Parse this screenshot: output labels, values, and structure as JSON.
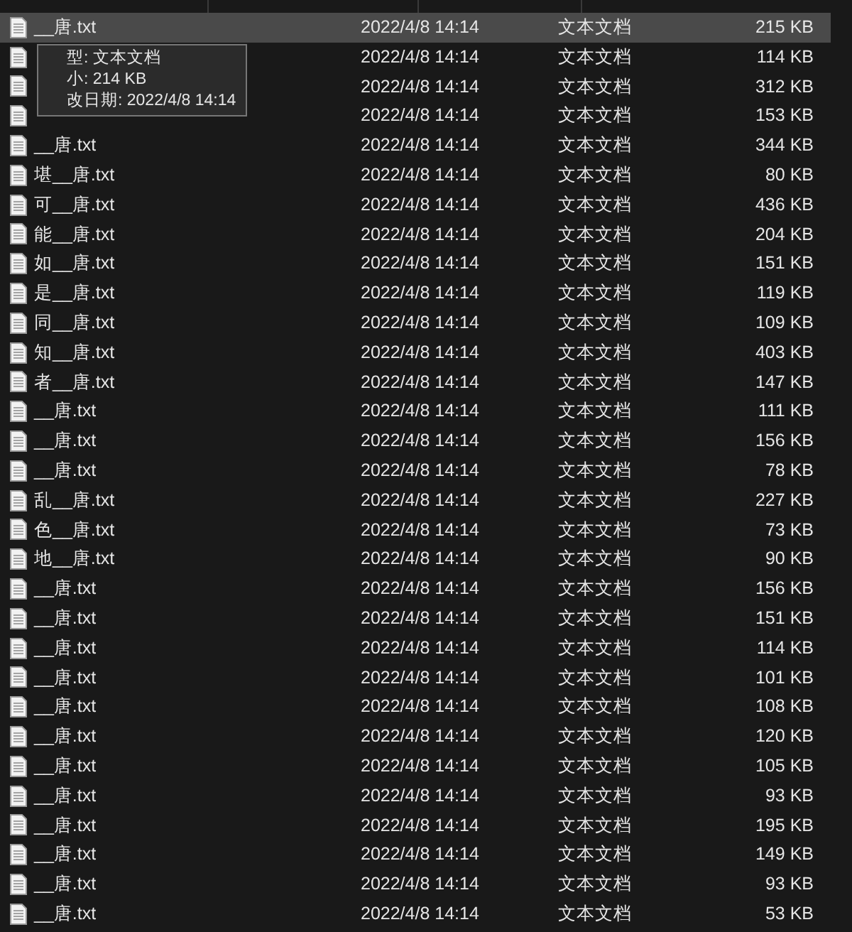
{
  "files": [
    {
      "name": "__唐.txt",
      "modified": "2022/4/8 14:14",
      "type": "文本文档",
      "size": "215 KB",
      "selected": true
    },
    {
      "modified": "2022/4/8 14:14",
      "type": "文本文档",
      "size": "114 KB",
      "selected": false
    },
    {
      "modified": "2022/4/8 14:14",
      "type": "文本文档",
      "size": "312 KB",
      "selected": false
    },
    {
      "modified": "2022/4/8 14:14",
      "type": "文本文档",
      "size": "153 KB",
      "selected": false
    },
    {
      "name": "__唐.txt",
      "modified": "2022/4/8 14:14",
      "type": "文本文档",
      "size": "344 KB",
      "selected": false
    },
    {
      "name": "堪__唐.txt",
      "modified": "2022/4/8 14:14",
      "type": "文本文档",
      "size": "80 KB",
      "selected": false
    },
    {
      "name": "可__唐.txt",
      "modified": "2022/4/8 14:14",
      "type": "文本文档",
      "size": "436 KB",
      "selected": false
    },
    {
      "name": "能__唐.txt",
      "modified": "2022/4/8 14:14",
      "type": "文本文档",
      "size": "204 KB",
      "selected": false
    },
    {
      "name": "如__唐.txt",
      "modified": "2022/4/8 14:14",
      "type": "文本文档",
      "size": "151 KB",
      "selected": false
    },
    {
      "name": "是__唐.txt",
      "modified": "2022/4/8 14:14",
      "type": "文本文档",
      "size": "119 KB",
      "selected": false
    },
    {
      "name": "同__唐.txt",
      "modified": "2022/4/8 14:14",
      "type": "文本文档",
      "size": "109 KB",
      "selected": false
    },
    {
      "name": "知__唐.txt",
      "modified": "2022/4/8 14:14",
      "type": "文本文档",
      "size": "403 KB",
      "selected": false
    },
    {
      "name": "者__唐.txt",
      "modified": "2022/4/8 14:14",
      "type": "文本文档",
      "size": "147 KB",
      "selected": false
    },
    {
      "name": "__唐.txt",
      "modified": "2022/4/8 14:14",
      "type": "文本文档",
      "size": "111 KB",
      "selected": false
    },
    {
      "name": "__唐.txt",
      "modified": "2022/4/8 14:14",
      "type": "文本文档",
      "size": "156 KB",
      "selected": false
    },
    {
      "name": "__唐.txt",
      "modified": "2022/4/8 14:14",
      "type": "文本文档",
      "size": "78 KB",
      "selected": false
    },
    {
      "name": "乱__唐.txt",
      "modified": "2022/4/8 14:14",
      "type": "文本文档",
      "size": "227 KB",
      "selected": false
    },
    {
      "name": "色__唐.txt",
      "modified": "2022/4/8 14:14",
      "type": "文本文档",
      "size": "73 KB",
      "selected": false
    },
    {
      "name": "地__唐.txt",
      "modified": "2022/4/8 14:14",
      "type": "文本文档",
      "size": "90 KB",
      "selected": false
    },
    {
      "name": "__唐.txt",
      "modified": "2022/4/8 14:14",
      "type": "文本文档",
      "size": "156 KB",
      "selected": false
    },
    {
      "name": "__唐.txt",
      "modified": "2022/4/8 14:14",
      "type": "文本文档",
      "size": "151 KB",
      "selected": false
    },
    {
      "name": "__唐.txt",
      "modified": "2022/4/8 14:14",
      "type": "文本文档",
      "size": "114 KB",
      "selected": false
    },
    {
      "name": "__唐.txt",
      "modified": "2022/4/8 14:14",
      "type": "文本文档",
      "size": "101 KB",
      "selected": false
    },
    {
      "name": "__唐.txt",
      "modified": "2022/4/8 14:14",
      "type": "文本文档",
      "size": "108 KB",
      "selected": false
    },
    {
      "name": "__唐.txt",
      "modified": "2022/4/8 14:14",
      "type": "文本文档",
      "size": "120 KB",
      "selected": false
    },
    {
      "name": "__唐.txt",
      "modified": "2022/4/8 14:14",
      "type": "文本文档",
      "size": "105 KB",
      "selected": false
    },
    {
      "name": "__唐.txt",
      "modified": "2022/4/8 14:14",
      "type": "文本文档",
      "size": "93 KB",
      "selected": false
    },
    {
      "name": "__唐.txt",
      "modified": "2022/4/8 14:14",
      "type": "文本文档",
      "size": "195 KB",
      "selected": false
    },
    {
      "name": "__唐.txt",
      "modified": "2022/4/8 14:14",
      "type": "文本文档",
      "size": "149 KB",
      "selected": false
    },
    {
      "name": "__唐.txt",
      "modified": "2022/4/8 14:14",
      "type": "文本文档",
      "size": "93 KB",
      "selected": false
    },
    {
      "name": "__唐.txt",
      "modified": "2022/4/8 14:14",
      "type": "文本文档",
      "size": "53 KB",
      "selected": false
    }
  ],
  "tooltip": {
    "lines": [
      "型: 文本文档",
      "小: 214 KB",
      "改日期: 2022/4/8 14:14"
    ]
  }
}
